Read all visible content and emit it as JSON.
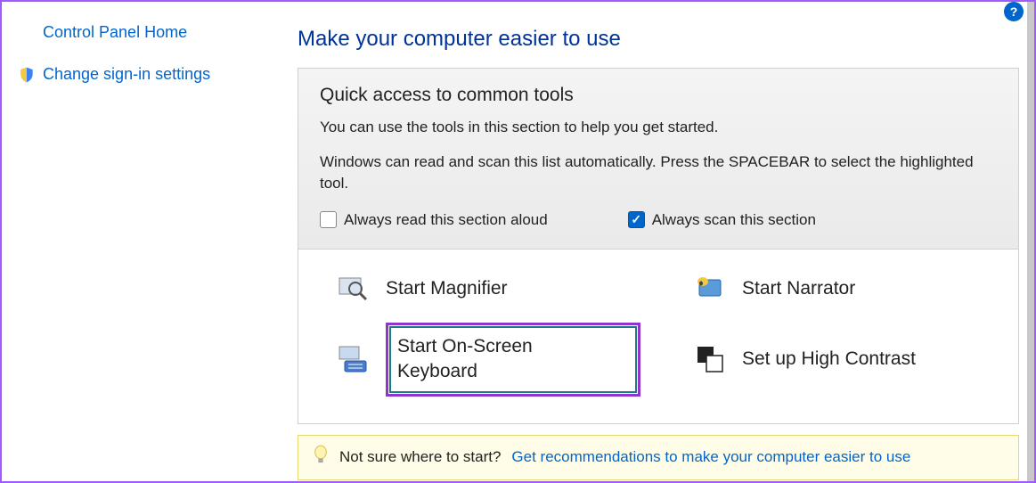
{
  "sidebar": {
    "home_link": "Control Panel Home",
    "signin_link": "Change sign-in settings"
  },
  "main": {
    "page_title": "Make your computer easier to use",
    "quick_access": {
      "title": "Quick access to common tools",
      "description1": "You can use the tools in this section to help you get started.",
      "description2": "Windows can read and scan this list automatically.  Press the SPACEBAR to select the highlighted tool.",
      "checkbox_read": "Always read this section aloud",
      "checkbox_scan": "Always scan this section",
      "checkbox_read_checked": false,
      "checkbox_scan_checked": true
    },
    "tools": {
      "magnifier": "Start Magnifier",
      "narrator": "Start Narrator",
      "onscreen_keyboard": "Start On-Screen Keyboard",
      "high_contrast": "Set up High Contrast"
    },
    "recommendation": {
      "prompt": "Not sure where to start?",
      "link": "Get recommendations to make your computer easier to use"
    }
  }
}
